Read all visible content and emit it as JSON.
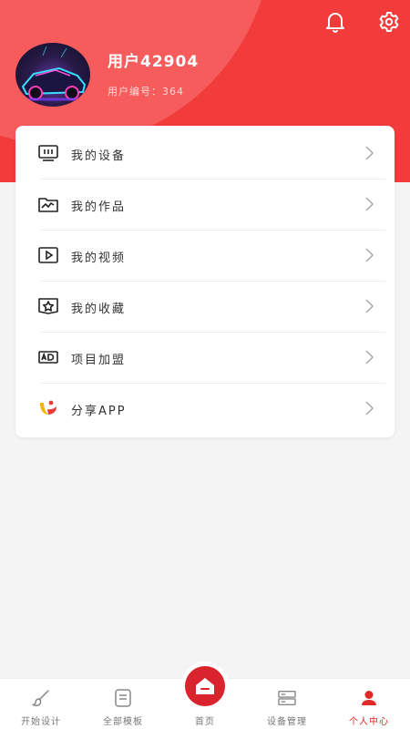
{
  "header": {
    "username": "用户42904",
    "user_id": "用户编号：364",
    "icons": [
      "bell-icon",
      "gear-icon"
    ]
  },
  "menu": [
    {
      "label": "我的设备",
      "icon": "device-icon"
    },
    {
      "label": "我的作品",
      "icon": "folder-chart-icon"
    },
    {
      "label": "我的视频",
      "icon": "play-icon"
    },
    {
      "label": "我的收藏",
      "icon": "star-folder-icon"
    },
    {
      "label": "项目加盟",
      "icon": "ad-icon"
    },
    {
      "label": "分享APP",
      "icon": "share-logo-icon"
    }
  ],
  "tabbar": {
    "tabs": [
      {
        "label": "开始设计",
        "icon": "brush-icon"
      },
      {
        "label": "全部模板",
        "icon": "template-icon"
      },
      {
        "label": "首页",
        "icon": "home-icon"
      },
      {
        "label": "设备管理",
        "icon": "server-icon"
      },
      {
        "label": "个人中心",
        "icon": "person-icon",
        "active": true
      }
    ]
  },
  "colors": {
    "primary": "#f23b3b",
    "primary_light": "#f65c5c",
    "home_button": "#d9232d",
    "active_tab": "#e32929"
  }
}
